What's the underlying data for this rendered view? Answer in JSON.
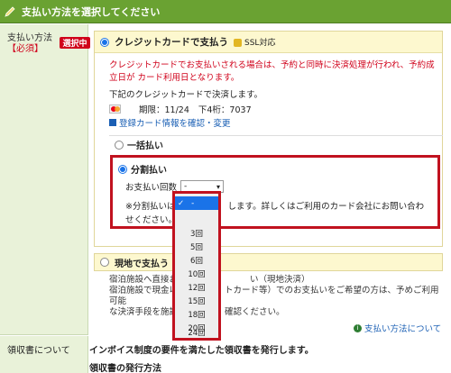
{
  "header": {
    "title": "支払い方法を選択してください"
  },
  "payment": {
    "label": "支払い方法",
    "required": "【必須】",
    "selected_badge": "選択中"
  },
  "credit": {
    "title": "クレジットカードで支払う",
    "ssl": "SSL対応",
    "notice": "クレジットカードでお支払いされる場合は、予約と同時に決済処理が行われ、予約成立日が カード利用日となります。",
    "decide_text": "下記のクレジットカードで決済します。",
    "expiry": "期限：11/24",
    "last4": "下4桁：7037",
    "register_link": "登録カード情報を確認・変更",
    "lump_sum": "一括払い",
    "installment": "分割払い",
    "times_label": "お支払い回数",
    "times_value": "-",
    "installment_note": "※分割払いは",
    "installment_note_rest": "します。詳しくはご利用のカード会社にお問い合わせください。",
    "installment_note_tail": "い。"
  },
  "dropdown": {
    "options": [
      "-",
      "3回",
      "5回",
      "6回",
      "10回",
      "12回",
      "15回",
      "18回",
      "20回",
      "24回"
    ],
    "selected_index": 0,
    "check": "✓"
  },
  "genchi": {
    "title": "現地で支払う",
    "line1_a": "宿泊施設へ直接お",
    "line1_b": "い（現地決済）",
    "line2_a": "宿泊施設で現金以",
    "line2_b": "トカード等）でのお支払いをご希望の方は、予めご利用可能",
    "line3_a": "な決済手段を施設",
    "line3_b": "確認ください。",
    "about_link": "支払い方法について"
  },
  "receipt": {
    "label": "領収書について",
    "line1": "インボイス制度の要件を満たした領収書を発行します。",
    "line2": "領収書の発行方法"
  },
  "colors": {
    "header": "#6aa232",
    "accent_red": "#c1121f",
    "link": "#1a5fb4",
    "select_blue": "#1a73e8"
  }
}
